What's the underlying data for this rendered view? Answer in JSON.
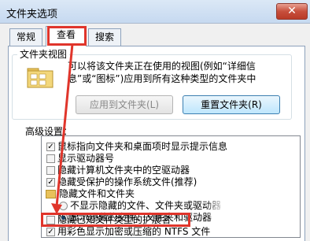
{
  "window": {
    "title": "文件夹选项",
    "close_glyph": "✕"
  },
  "tabs": [
    {
      "label": "常规"
    },
    {
      "label": "查看"
    },
    {
      "label": "搜索"
    }
  ],
  "folder_view": {
    "label": "文件夹视图",
    "description": "可以将该文件夹正在使用的视图(例如“详细信息”或“图标”)应用到所有这种类型的文件夹中",
    "apply_button": "应用到文件夹(L)",
    "reset_button": "重置文件夹(R)"
  },
  "advanced": {
    "label": "高级设置：",
    "items": [
      {
        "kind": "checkbox",
        "checked": true,
        "label": "鼠标指向文件夹和桌面项时显示提示信息"
      },
      {
        "kind": "checkbox",
        "checked": false,
        "label": "显示驱动器号"
      },
      {
        "kind": "checkbox",
        "checked": false,
        "label": "隐藏计算机文件夹中的空驱动器"
      },
      {
        "kind": "checkbox",
        "checked": true,
        "label": "隐藏受保护的操作系统文件(推荐)"
      },
      {
        "kind": "folder",
        "label": "隐藏文件和文件夹"
      },
      {
        "kind": "radio",
        "selected": false,
        "label": "不显示隐藏的文件、文件夹或驱动器"
      },
      {
        "kind": "radio",
        "selected": true,
        "label": "显示隐藏的文件、文件夹和驱动器"
      },
      {
        "kind": "checkbox",
        "checked": false,
        "label": "隐藏已知文件类型的扩展名"
      },
      {
        "kind": "checkbox",
        "checked": true,
        "label": "用彩色显示加密或压缩的 NTFS 文件"
      }
    ]
  },
  "colors": {
    "annotation_red": "#e0352b",
    "title_bar": "#c6d9f0"
  }
}
